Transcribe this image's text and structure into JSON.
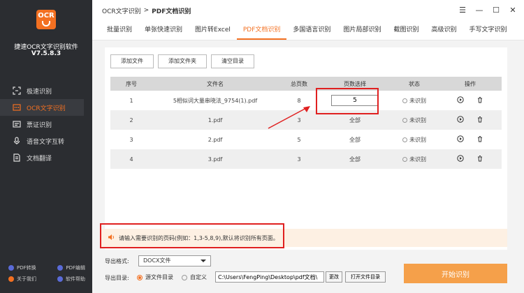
{
  "app": {
    "logo_text": "OCR",
    "name": "捷速OCR文字识别软件",
    "version": "V7.5.8.3"
  },
  "sidebar": {
    "items": [
      {
        "label": "极速识别",
        "icon": "scan-icon"
      },
      {
        "label": "OCR文字识别",
        "icon": "ocr-icon",
        "active": true
      },
      {
        "label": "票证识别",
        "icon": "ticket-icon"
      },
      {
        "label": "语音文字互转",
        "icon": "microphone-icon"
      },
      {
        "label": "文档翻译",
        "icon": "translate-icon"
      }
    ],
    "footer": [
      {
        "label": "PDF转换"
      },
      {
        "label": "PDF编辑"
      },
      {
        "label": "关于我们"
      },
      {
        "label": "软件帮助"
      }
    ]
  },
  "titlebar": {
    "crumb1": "OCR文字识别",
    "crumb_sep": ">",
    "crumb2": "PDF文档识别"
  },
  "tabs": [
    {
      "label": "批量识别"
    },
    {
      "label": "单张快速识别"
    },
    {
      "label": "图片转Excel"
    },
    {
      "label": "PDF文档识别",
      "active": true
    },
    {
      "label": "多国语言识别"
    },
    {
      "label": "图片局部识别"
    },
    {
      "label": "截图识别"
    },
    {
      "label": "高级识别"
    },
    {
      "label": "手写文字识别"
    }
  ],
  "toolbar": {
    "add_file": "添加文件",
    "add_folder": "添加文件夹",
    "clear": "清空目录"
  },
  "table": {
    "headers": [
      "序号",
      "文件名",
      "总页数",
      "页数选择",
      "状态",
      "操作"
    ],
    "rows": [
      {
        "index": "1",
        "filename": "5相似词大量串晓法_9754(1).pdf",
        "pages": "8",
        "selection": "5",
        "status": "未识别"
      },
      {
        "index": "2",
        "filename": "1.pdf",
        "pages": "3",
        "selection": "全部",
        "status": "未识别"
      },
      {
        "index": "3",
        "filename": "2.pdf",
        "pages": "5",
        "selection": "全部",
        "status": "未识别"
      },
      {
        "index": "4",
        "filename": "3.pdf",
        "pages": "3",
        "selection": "全部",
        "status": "未识别"
      }
    ]
  },
  "notice": {
    "text": "请输入需要识别的页码(例如：1,3-5,8,9),默认将识别所有页面。"
  },
  "bottom": {
    "format_label": "导出格式:",
    "format_value": "DOCX文件",
    "dir_label": "导出目录:",
    "radio_source": "源文件目录",
    "radio_custom": "自定义",
    "path_value": "C:\\Users\\FengPing\\Desktop\\pdf文档\\",
    "change_btn": "更改",
    "open_btn": "打开文件目录",
    "start_btn": "开始识别"
  },
  "colors": {
    "accent": "#f37021",
    "highlight": "#e02020",
    "sidebar_bg": "#2b2d31"
  }
}
